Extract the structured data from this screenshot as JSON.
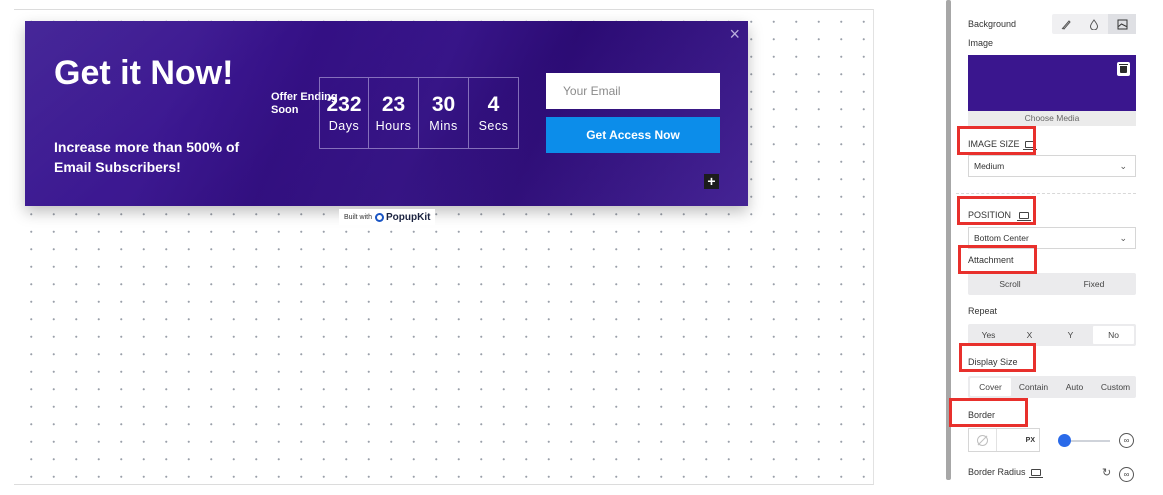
{
  "popup": {
    "headline": "Get it Now!",
    "subline": "Increase more than 500% of Email Subscribers!",
    "offer_label": "Offer Ending Soon",
    "countdown": [
      {
        "value": "232",
        "unit": "Days"
      },
      {
        "value": "23",
        "unit": "Hours"
      },
      {
        "value": "30",
        "unit": "Mins"
      },
      {
        "value": "4",
        "unit": "Secs"
      }
    ],
    "email_placeholder": "Your Email",
    "cta_label": "Get Access Now",
    "close_glyph": "×",
    "plus_glyph": "+"
  },
  "built_with": {
    "prefix": "Built with",
    "brand": "PopupKit"
  },
  "sidebar": {
    "background_label": "Background",
    "image_label": "Image",
    "bg_tools": [
      "brush-icon",
      "droplet-icon",
      "image-icon"
    ],
    "choose_media": "Choose Media",
    "image_size_label": "IMAGE SIZE",
    "image_size_value": "Medium",
    "position_label": "POSITION",
    "position_value": "Bottom Center",
    "attachment_label": "Attachment",
    "attachment_options": [
      "Scroll",
      "Fixed"
    ],
    "repeat_label": "Repeat",
    "repeat_options": [
      "Yes",
      "X",
      "Y",
      "No"
    ],
    "repeat_selected": "No",
    "display_size_label": "Display Size",
    "display_size_options": [
      "Cover",
      "Contain",
      "Auto",
      "Custom"
    ],
    "display_size_selected": "Cover",
    "border_label": "Border",
    "border_unit": "PX",
    "border_radius_label": "Border Radius"
  },
  "colors": {
    "popup_bg": "#3a168e",
    "cta": "#0c8dea",
    "highlight": "#e8302c",
    "slider": "#2a6ae9"
  }
}
